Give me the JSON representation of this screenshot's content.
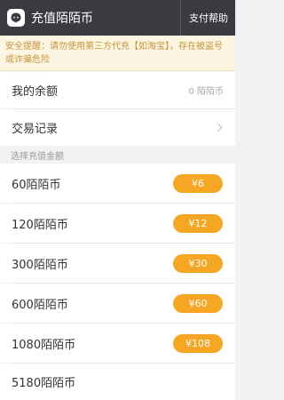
{
  "header": {
    "title": "充值陌陌币",
    "help_label": "支付帮助",
    "app_icon": "momo-logo-icon"
  },
  "notice": {
    "text": "安全提醒：请勿使用第三方代充【如淘宝】，存在被盗号或诈骗危险"
  },
  "balance": {
    "label": "我的余额",
    "value": "0 陌陌币"
  },
  "records": {
    "label": "交易记录",
    "icon": "chevron-right-icon"
  },
  "section": {
    "label": "选择充值金额"
  },
  "options": [
    {
      "amount": "60陌陌币",
      "price": "¥6"
    },
    {
      "amount": "120陌陌币",
      "price": "¥12"
    },
    {
      "amount": "300陌陌币",
      "price": "¥30"
    },
    {
      "amount": "600陌陌币",
      "price": "¥60"
    },
    {
      "amount": "1080陌陌币",
      "price": "¥108"
    },
    {
      "amount": "5180陌陌币",
      "price": ""
    }
  ],
  "colors": {
    "titlebar": "#3b3a40",
    "accent": "#f5a623",
    "notice_text": "#c8943c",
    "notice_bg": "#fcf5e2"
  }
}
